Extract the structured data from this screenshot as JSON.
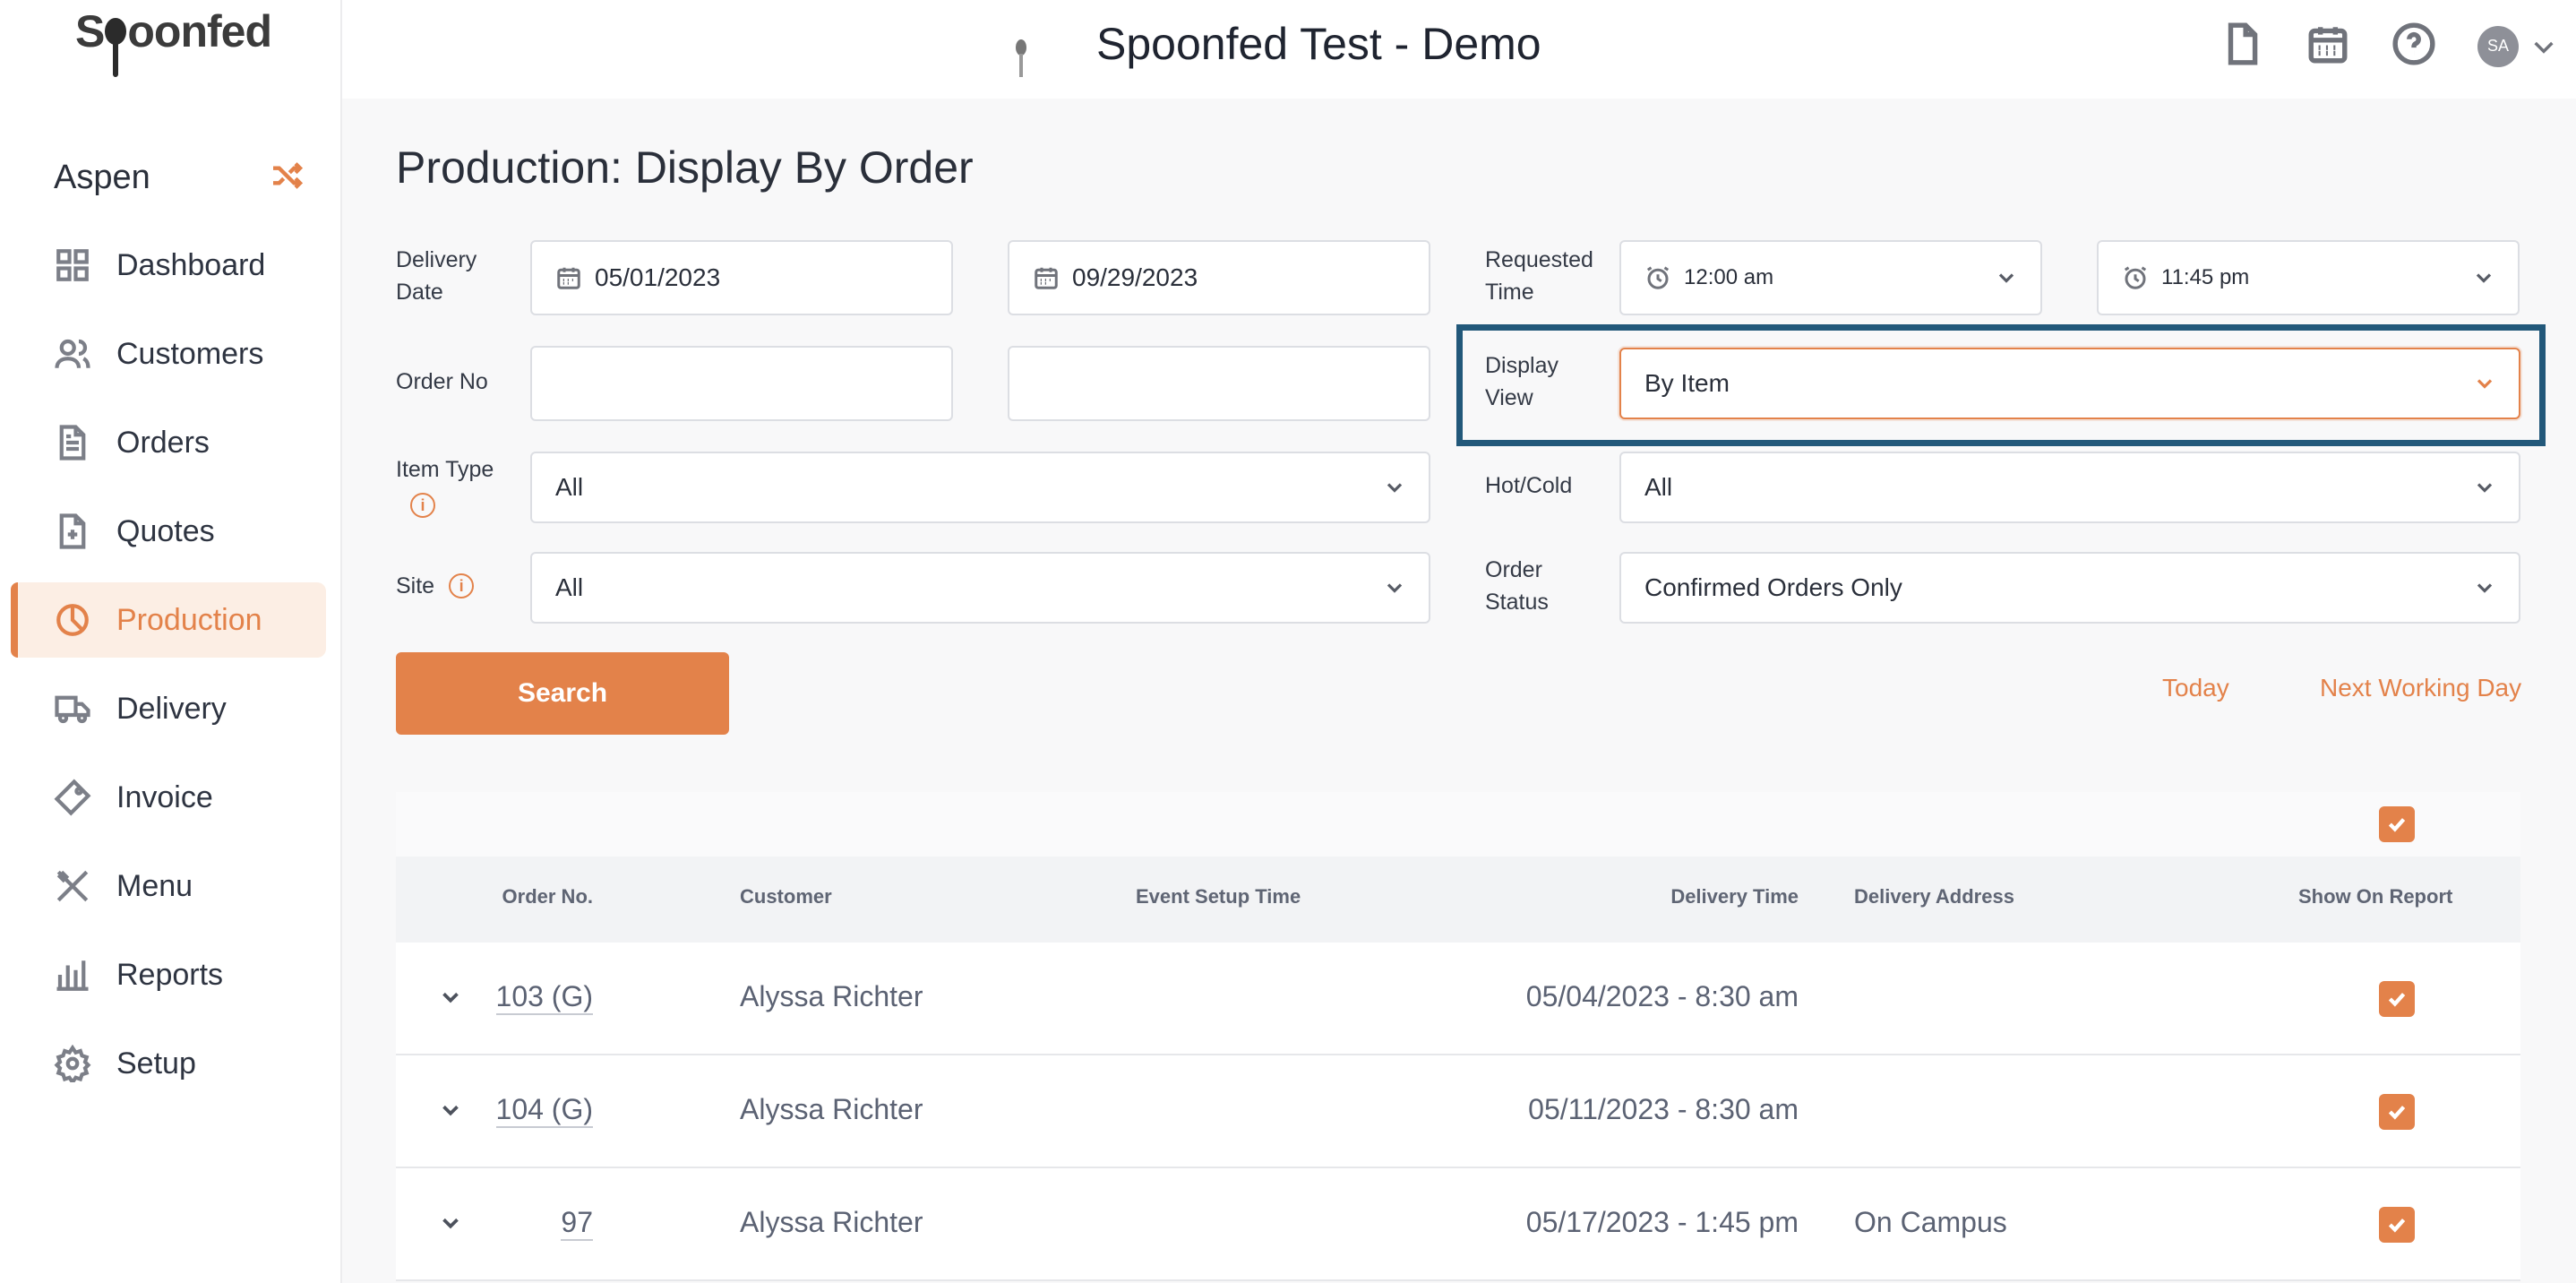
{
  "app": {
    "logo_text_pre": "S",
    "logo_text_post": "oonfed",
    "tenant_title": "Spoonfed Test - Demo",
    "user_initials": "SA"
  },
  "sidebar": {
    "tenant": "Aspen",
    "items": [
      {
        "label": "Dashboard",
        "icon": "grid-icon"
      },
      {
        "label": "Customers",
        "icon": "users-icon"
      },
      {
        "label": "Orders",
        "icon": "document-icon"
      },
      {
        "label": "Quotes",
        "icon": "document-plus-icon"
      },
      {
        "label": "Production",
        "icon": "pie-icon",
        "active": true
      },
      {
        "label": "Delivery",
        "icon": "truck-icon"
      },
      {
        "label": "Invoice",
        "icon": "ticket-icon"
      },
      {
        "label": "Menu",
        "icon": "utensils-icon"
      },
      {
        "label": "Reports",
        "icon": "bar-chart-icon"
      },
      {
        "label": "Setup",
        "icon": "gear-icon"
      }
    ]
  },
  "page": {
    "title": "Production: Display By Order"
  },
  "filters": {
    "delivery_date_label_1": "Delivery",
    "delivery_date_label_2": "Date",
    "date_from": "05/01/2023",
    "date_to": "09/29/2023",
    "requested_time_label_1": "Requested",
    "requested_time_label_2": "Time",
    "time_from": "12:00 am",
    "time_to": "11:45 pm",
    "order_no_label": "Order No",
    "order_no_from": "",
    "order_no_to": "",
    "display_view_label_1": "Display",
    "display_view_label_2": "View",
    "display_view": "By Item",
    "item_type_label": "Item Type",
    "item_type": "All",
    "hot_cold_label": "Hot/Cold",
    "hot_cold": "All",
    "site_label": "Site",
    "site": "All",
    "order_status_label_1": "Order",
    "order_status_label_2": "Status",
    "order_status": "Confirmed Orders Only",
    "info_glyph": "i"
  },
  "actions": {
    "search": "Search",
    "today": "Today",
    "next_working_day": "Next Working Day"
  },
  "table": {
    "headers": {
      "order_no": "Order No.",
      "customer": "Customer",
      "event_setup_time": "Event Setup Time",
      "delivery_time": "Delivery Time",
      "delivery_address": "Delivery Address",
      "show_on_report": "Show On Report"
    },
    "select_all_checked": true,
    "rows": [
      {
        "order_no": "103 (G)",
        "customer": "Alyssa Richter",
        "event_setup_time": "",
        "delivery_time": "05/04/2023 - 8:30 am",
        "delivery_address": "",
        "show_on_report": true
      },
      {
        "order_no": "104 (G)",
        "customer": "Alyssa Richter",
        "event_setup_time": "",
        "delivery_time": "05/11/2023 - 8:30 am",
        "delivery_address": "",
        "show_on_report": true
      },
      {
        "order_no": "97",
        "customer": "Alyssa Richter",
        "event_setup_time": "",
        "delivery_time": "05/17/2023 - 1:45 pm",
        "delivery_address": "On Campus",
        "show_on_report": true
      }
    ]
  },
  "colors": {
    "accent": "#e3824a",
    "highlight_box": "#22587a",
    "active_nav_bg": "#fceee4"
  }
}
